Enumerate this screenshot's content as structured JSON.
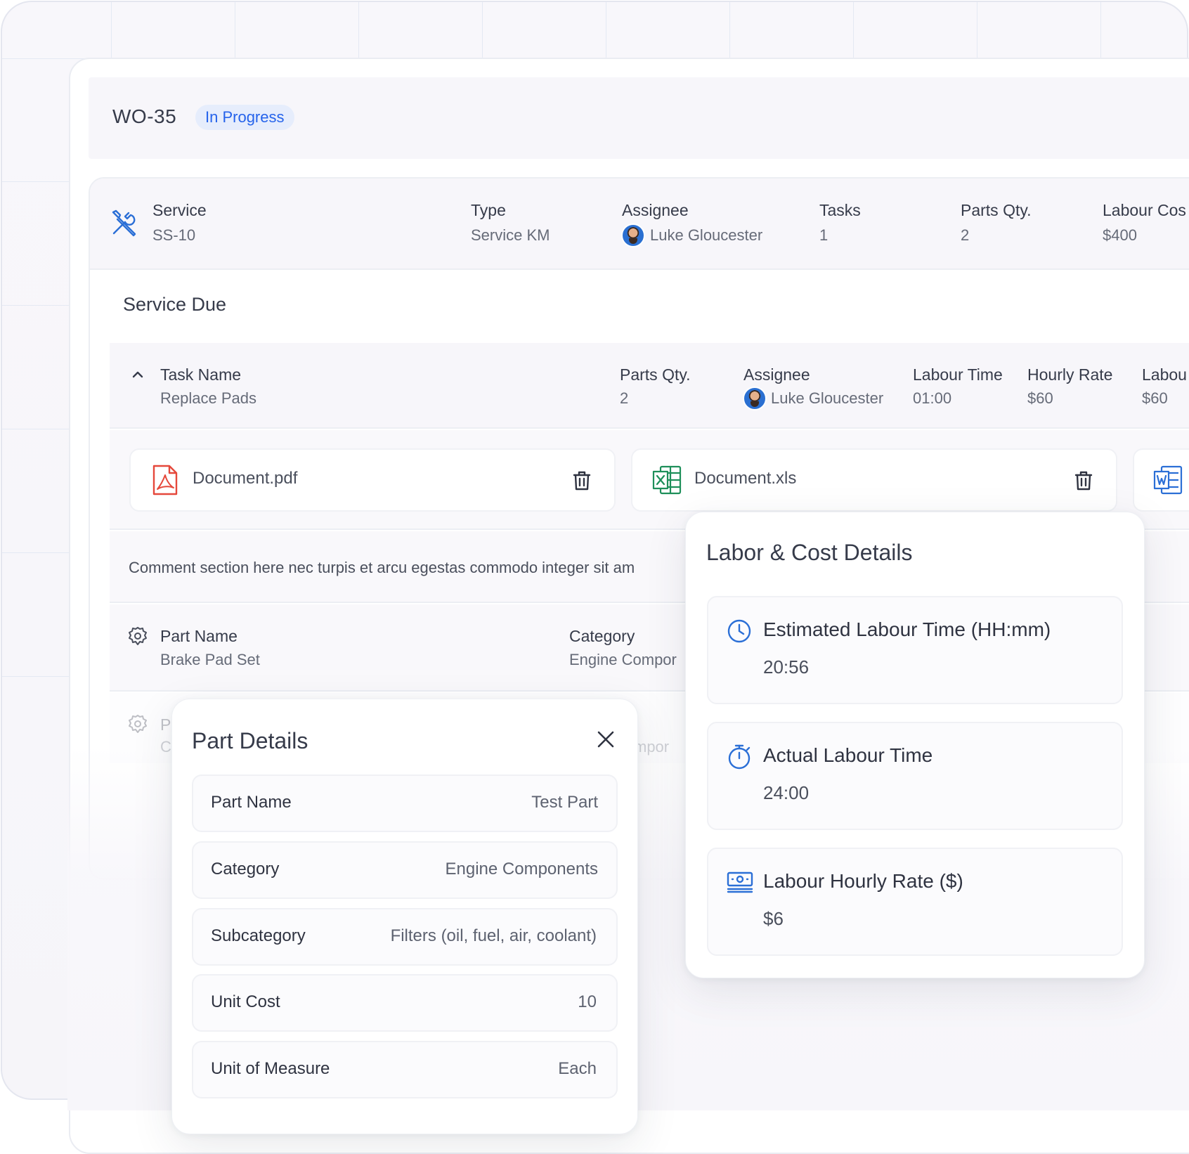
{
  "work_order": {
    "id": "WO-35",
    "status": "In Progress"
  },
  "service": {
    "service_label": "Service",
    "service_value": "SS-10",
    "type_label": "Type",
    "type_value": "Service KM",
    "assignee_label": "Assignee",
    "assignee_value": "Luke Gloucester",
    "tasks_label": "Tasks",
    "tasks_value": "1",
    "parts_label": "Parts Qty.",
    "parts_value": "2",
    "labour_cost_label": "Labour Cos",
    "labour_cost_value": "$400"
  },
  "section_title": "Service Due",
  "task": {
    "name_label": "Task Name",
    "name_value": "Replace Pads",
    "parts_label": "Parts Qty.",
    "parts_value": "2",
    "assignee_label": "Assignee",
    "assignee_value": "Luke Gloucester",
    "time_label": "Labour Time",
    "time_value": "01:00",
    "rate_label": "Hourly Rate",
    "rate_value": "$60",
    "labour_label": "Labou",
    "labour_value": "$60"
  },
  "attachments": [
    {
      "name": "Document.pdf",
      "icon": "pdf-file-icon"
    },
    {
      "name": "Document.xls",
      "icon": "excel-file-icon"
    },
    {
      "name": "",
      "icon": "word-file-icon"
    }
  ],
  "comment": "Comment section here nec turpis et arcu egestas commodo integer sit am",
  "part": {
    "name_label": "Part Name",
    "name_value": "Brake Pad Set",
    "category_label": "Category",
    "category_value": "Engine Compor"
  },
  "part_row2": {
    "name_label": "P",
    "name_value": "C",
    "category_value": "mpor"
  },
  "part_details": {
    "title": "Part Details",
    "rows": [
      {
        "label": "Part Name",
        "value": "Test Part"
      },
      {
        "label": "Category",
        "value": "Engine Components"
      },
      {
        "label": "Subcategory",
        "value": "Filters (oil, fuel, air, coolant)"
      },
      {
        "label": "Unit Cost",
        "value": "10"
      },
      {
        "label": "Unit of Measure",
        "value": "Each"
      }
    ]
  },
  "labor_cost": {
    "title": "Labor & Cost Details",
    "items": [
      {
        "label": "Estimated Labour Time (HH:mm)",
        "value": "20:56",
        "icon": "clock-icon"
      },
      {
        "label": "Actual Labour Time",
        "value": "24:00",
        "icon": "stopwatch-icon"
      },
      {
        "label": "Labour Hourly Rate ($)",
        "value": "$6",
        "icon": "cash-icon"
      }
    ]
  },
  "colors": {
    "accent": "#2563eb",
    "status_bg": "#e6edfc",
    "pdf": "#e5483b",
    "excel": "#1e8f5a",
    "word": "#2b6fd6"
  }
}
